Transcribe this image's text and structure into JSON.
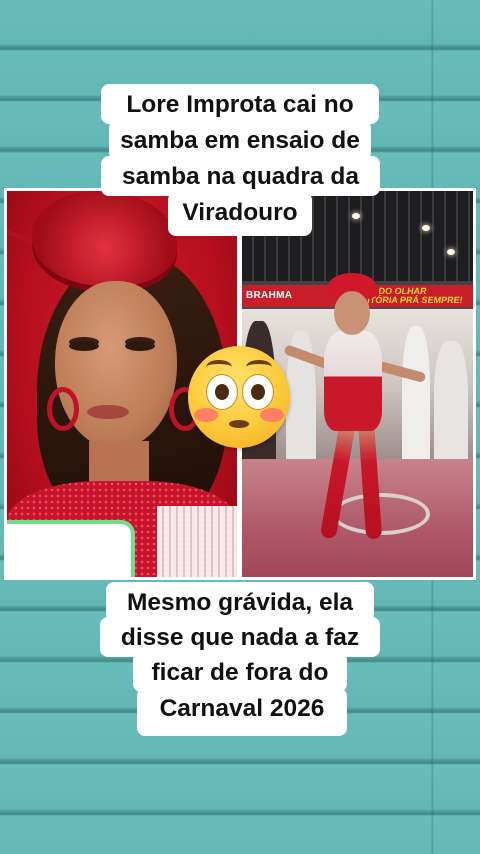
{
  "caption_top": {
    "lines": [
      "Lore Improta cai no",
      "samba em ensaio de",
      "samba na quadra da",
      "Viradouro"
    ]
  },
  "caption_bottom": {
    "lines": [
      "Mesmo grávida, ela",
      "disse que nada a faz",
      "ficar de fora do",
      "Carnaval 2026"
    ]
  },
  "photo_right": {
    "banner_brand": "BRAHMA",
    "banner_slogan_1": "HÓ DO OLHAR",
    "banner_slogan_2": "VITÓRIA PRÁ SEMPRE!"
  },
  "emoji": {
    "name": "flushed-face-icon",
    "symbol": "😳"
  },
  "colors": {
    "background": "#5fb2b1",
    "caption_bg": "#ffffff",
    "caption_text": "#111111",
    "accent_red": "#c8142a",
    "accent_green": "#6fe08a"
  }
}
